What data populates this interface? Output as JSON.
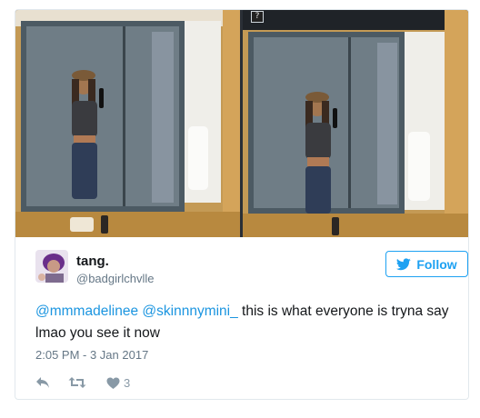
{
  "media": {
    "help_badge": "?",
    "images": [
      {
        "icon": "mirror-selfie-photo"
      },
      {
        "icon": "mirror-selfie-photo"
      }
    ]
  },
  "tweet": {
    "display_name": "tang.",
    "handle": "@badgirlchvlle",
    "follow_label": "Follow",
    "mentions": [
      "@mmmadelinee",
      "@skinnnymini_"
    ],
    "body_text": " this is what everyone is tryna say lmao you see it now",
    "timestamp": "2:05 PM - 3 Jan 2017",
    "like_count": "3"
  },
  "colors": {
    "accent": "#1da1f2",
    "link": "#1b95e0",
    "muted": "#657786"
  }
}
